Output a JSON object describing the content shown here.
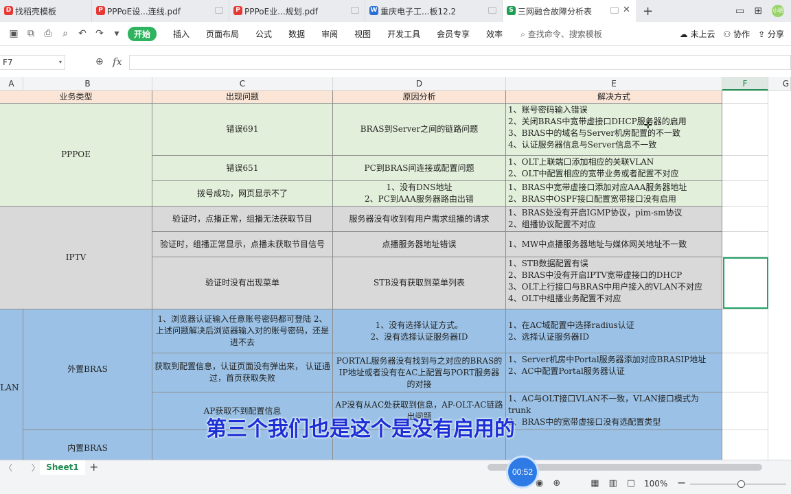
{
  "tabs": [
    {
      "label": "找稻壳模板",
      "icon": "daoke-icon",
      "icon_char": "D",
      "icon_color": "#e53935"
    },
    {
      "label": "PPPoE设...连线.pdf",
      "icon": "pdf-icon",
      "icon_char": "P",
      "icon_color": "#e53935"
    },
    {
      "label": "PPPoE业...规划.pdf",
      "icon": "pdf-icon",
      "icon_char": "P",
      "icon_color": "#e53935"
    },
    {
      "label": "重庆电子工...板12.2",
      "icon": "word-icon",
      "icon_char": "W",
      "icon_color": "#2b6fd6"
    },
    {
      "label": "三网融合故障分析表",
      "icon": "sheet-icon",
      "icon_char": "S",
      "icon_color": "#1e9e52"
    }
  ],
  "tabbar": {
    "add": "+",
    "avatar": "小明"
  },
  "menu": {
    "start": "开始",
    "items": [
      "插入",
      "页面布局",
      "公式",
      "数据",
      "审阅",
      "视图",
      "开发工具",
      "会员专享",
      "效率"
    ],
    "search": "查找命令、搜索模板",
    "cloud": "未上云",
    "collab": "协作",
    "share": "分享"
  },
  "formula": {
    "cell_ref": "F7",
    "fx": "fx",
    "value": ""
  },
  "columns": [
    "A",
    "B",
    "C",
    "D",
    "E",
    "F",
    "G"
  ],
  "table": {
    "header": {
      "type": "业务类型",
      "problem": "出现问题",
      "cause": "原因分析",
      "solution": "解决方式"
    },
    "pppoe": {
      "label": "PPPOE",
      "rows": [
        {
          "problem": "错误691",
          "cause": "BRAS到Server之间的链路问题",
          "solution": [
            "1、账号密码输入错误",
            "2、关闭BRAS中宽带虚接口DHCP服务器的启用",
            "3、BRAS中的域名与Server机房配置的不一致",
            "4、认证服务器信息与Server信息不一致"
          ]
        },
        {
          "problem": "错误651",
          "cause": "PC到BRAS间连接或配置问题",
          "solution": [
            "1、OLT上联端口添加相应的关联VLAN",
            "2、OLT中配置相应的宽带业务或者配置不对应"
          ]
        },
        {
          "problem": "拨号成功，网页显示不了",
          "cause": "1、没有DNS地址\n2、PC到AAA服务器路由出错",
          "solution": [
            "1、BRAS中宽带虚接口添加对应AAA服务器地址",
            "2、BRAS中OSPF接口配置宽带接口没有启用"
          ]
        }
      ]
    },
    "iptv": {
      "label": "IPTV",
      "rows": [
        {
          "problem": "验证时，点播正常，组播无法获取节目",
          "cause": "服务器没有收到有用户需求组播的请求",
          "solution": [
            "1、BRAS处没有开启IGMP协议，pim-sm协议",
            "2、组播协议配置不对应"
          ]
        },
        {
          "problem": "验证时，组播正常显示，点播未获取节目信号",
          "cause": "点播服务器地址错误",
          "solution": [
            "1、MW中点播服务器地址与媒体网关地址不一致"
          ]
        },
        {
          "problem": "验证时没有出现菜单",
          "cause": "STB没有获取到菜单列表",
          "solution": [
            "1、STB数据配置有误",
            "2、BRAS中没有开启IPTV宽带虚接口的DHCP",
            "3、OLT上行接口与BRAS中用户接入的VLAN不对应",
            "4、OLT中组播业务配置不对应"
          ]
        }
      ]
    },
    "wlan": {
      "label": "WLAN",
      "ext_label": "外置BRAS",
      "int_label": "内置BRAS",
      "rows": [
        {
          "problem": "1、浏览器认证输入任意账号密码都可登陆    2、上述问题解决后浏览器输入对的账号密码，还是进不去",
          "cause": "1、没有选择认证方式。\n2、没有选择认证服务器ID",
          "solution": [
            "1、在AC域配置中选择radius认证",
            "2、选择认证服务器ID"
          ]
        },
        {
          "problem": "获取到配置信息，认证页面没有弹出来，          认证通过，首页获取失败",
          "cause": "PORTAL服务器没有找到与之对应的BRAS的IP地址或者没有在AC上配置与PORT服务器的对接",
          "solution": [
            "1、Server机房中Portal服务器添加对应BRASIP地址",
            "2、AC中配置Portal服务器认证"
          ]
        },
        {
          "problem": "AP获取不到配置信息",
          "cause": "AP没有从AC处获取到信息，AP-OLT-AC链路出问题",
          "solution": [
            "1、AC与OLT接口VLAN不一致，VLAN接口模式为trunk",
            "2、BRAS中的宽带虚接口没有选配置类型"
          ]
        }
      ]
    }
  },
  "caption": "第三个我们也是这个是没有启用的",
  "sheet": {
    "nav": "〈 〉|",
    "tab": "Sheet1",
    "add": "+"
  },
  "status": {
    "timer": "00:52",
    "zoom": "100%",
    "zoom_minus": "−"
  },
  "colors": {
    "header_bg": "#fbe5d6",
    "pppoe_bg": "#e2efda",
    "iptv_bg": "#d9d9d9",
    "wlan_bg": "#9bc2e6",
    "accent": "#1e8a4f",
    "caption": "#1c2fd6"
  }
}
